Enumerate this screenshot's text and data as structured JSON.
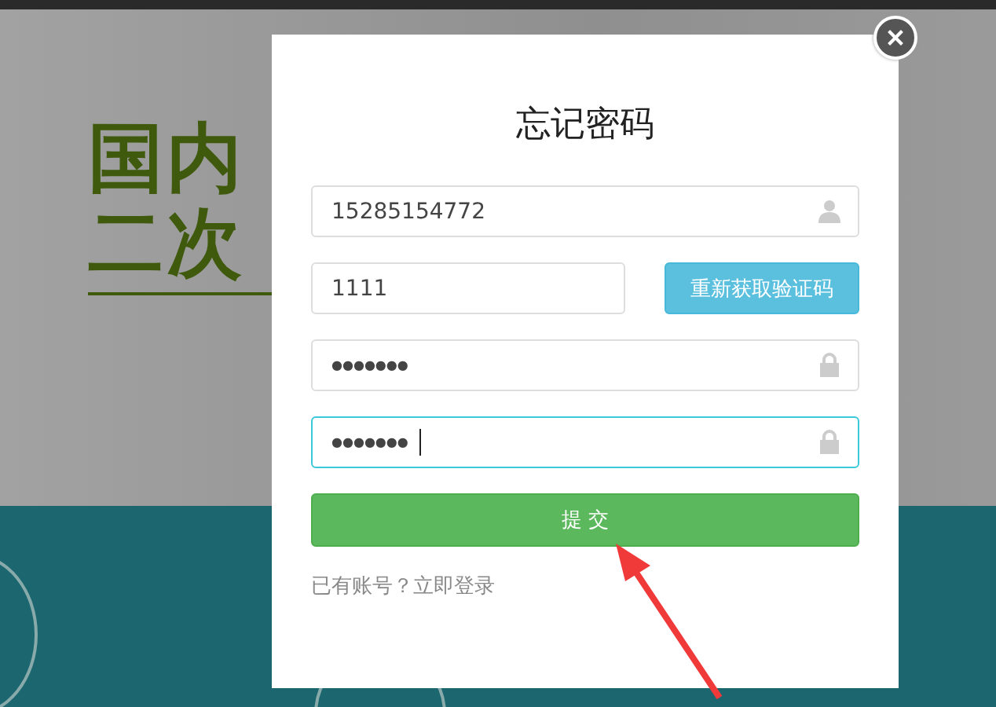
{
  "banner": {
    "lines": [
      "国内",
      "二次"
    ]
  },
  "dialog": {
    "title": "忘记密码",
    "fields": [
      {
        "kind": "text",
        "value": "15285154772",
        "focused": false
      },
      {
        "kind": "code",
        "value": "1111",
        "focused": false
      },
      {
        "kind": "password",
        "value": "●●●●●●●",
        "focused": false
      },
      {
        "kind": "password",
        "value": "●●●●●●●",
        "focused": true
      }
    ],
    "resend_button": "重新获取验证码",
    "submit_button": "提 交",
    "login_prompt": "已有账号？立即登录"
  }
}
